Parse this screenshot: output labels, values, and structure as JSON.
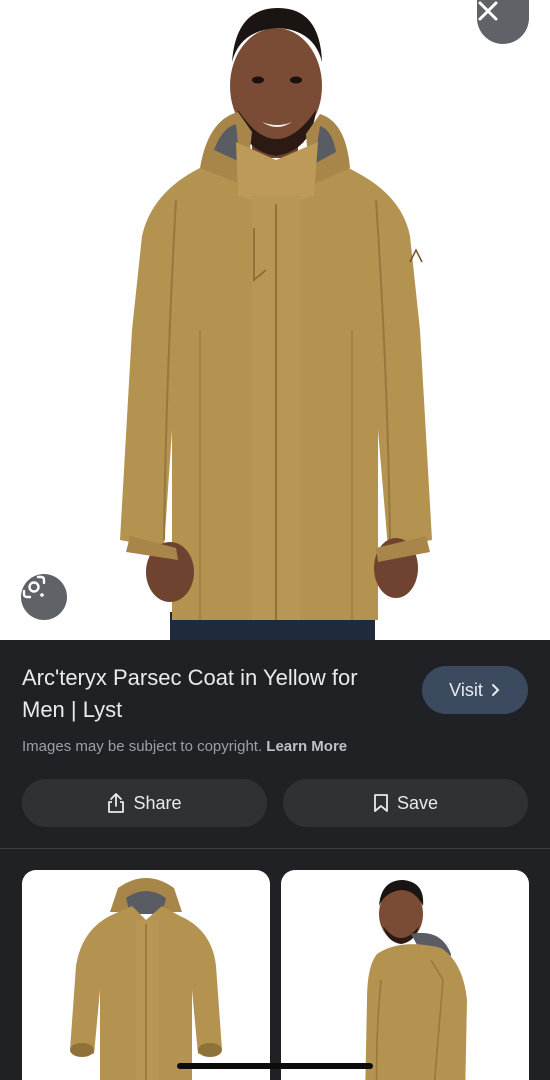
{
  "result": {
    "title": "Arc'teryx Parsec Coat in Yellow for Men | Lyst",
    "visit_label": "Visit",
    "copyright_text": "Images may be subject to copyright.",
    "learn_more_label": "Learn More",
    "share_label": "Share",
    "save_label": "Save"
  },
  "icons": {
    "close": "close-icon",
    "lens": "google-lens-icon",
    "share": "share-icon",
    "save": "bookmark-icon",
    "visit": "chevron-right-icon"
  },
  "colors": {
    "background": "#202124",
    "coat": "#b4924f",
    "visit_button": "#3c4a5f",
    "action_button": "#303134"
  }
}
